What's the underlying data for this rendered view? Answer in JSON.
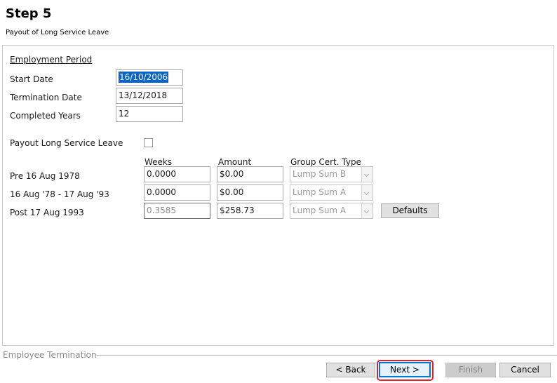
{
  "header": {
    "title": "Step 5",
    "subtitle": "Payout of Long Service Leave"
  },
  "employment": {
    "section_title": "Employment Period",
    "start_date_label": "Start Date",
    "start_date_value": "16/10/2006",
    "termination_date_label": "Termination Date",
    "termination_date_value": "13/12/2018",
    "completed_years_label": "Completed Years",
    "completed_years_value": "12"
  },
  "payout": {
    "checkbox_label": "Payout Long Service Leave",
    "checked": false,
    "col_weeks": "Weeks",
    "col_amount": "Amount",
    "col_group": "Group Cert. Type",
    "rows": [
      {
        "label": "Pre 16 Aug 1978",
        "weeks": "0.0000",
        "amount": "$0.00",
        "group": "Lump Sum B"
      },
      {
        "label": "16 Aug '78 - 17 Aug '93",
        "weeks": "0.0000",
        "amount": "$0.00",
        "group": "Lump Sum A"
      },
      {
        "label": "Post 17 Aug 1993",
        "weeks": "0.3585",
        "amount": "$258.73",
        "group": "Lump Sum A"
      }
    ],
    "defaults_label": "Defaults"
  },
  "footer": {
    "group_label": "Employee Termination",
    "back_label": "< Back",
    "next_label": "Next >",
    "finish_label": "Finish",
    "cancel_label": "Cancel"
  },
  "colors": {
    "selection": "#0a64c6",
    "focus_border": "#0078d7",
    "highlight": "#e0202a"
  }
}
